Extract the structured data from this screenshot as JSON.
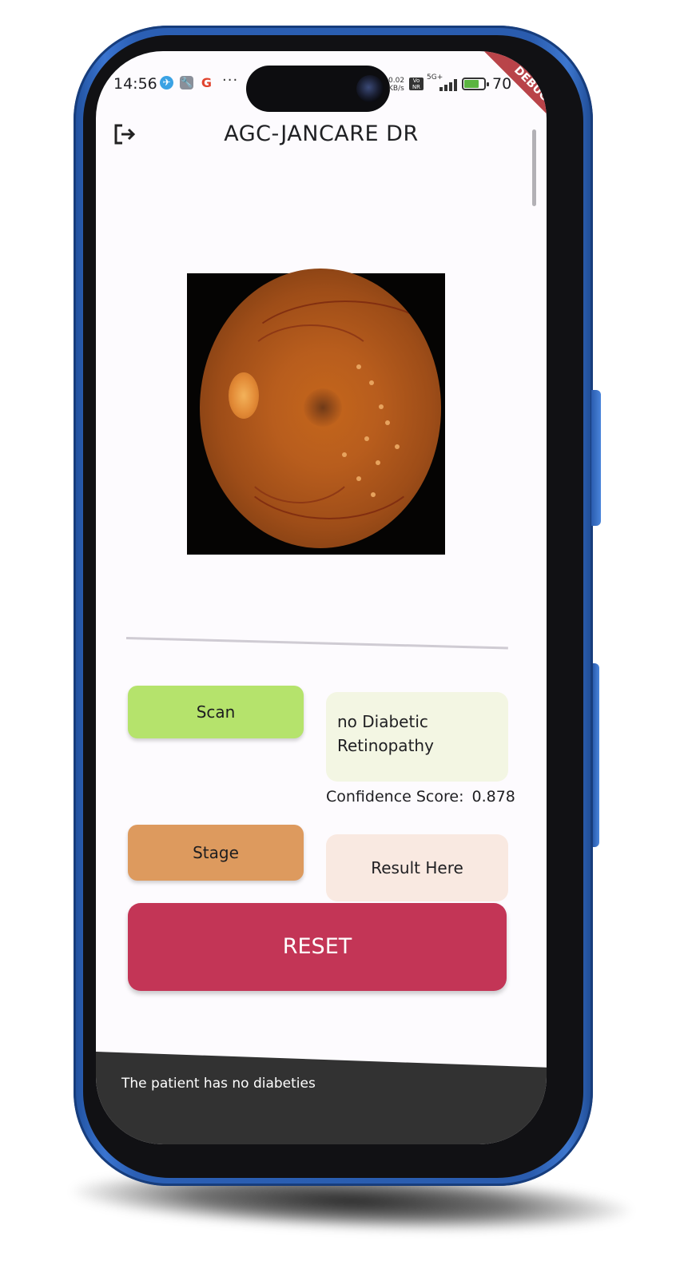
{
  "status_bar": {
    "time": "14:56",
    "more": "···",
    "net_speed": "0.02 KB/s",
    "network": "5G+",
    "battery": "70",
    "debug_banner": "DEBUG"
  },
  "app_bar": {
    "title": "AGC-JANCARE DR"
  },
  "actions": {
    "scan_label": "Scan",
    "scan_result": "no Diabetic Retinopathy",
    "confidence_label": "Confidence Score:",
    "confidence_value": "0.878",
    "stage_label": "Stage",
    "stage_result": "Result Here",
    "reset_label": "RESET"
  },
  "snackbar": {
    "message": "The patient has no diabeties"
  },
  "colors": {
    "scan": "#b5e36c",
    "stage": "#dd9a5e",
    "reset": "#c33556",
    "phone_frame": "#2a5cae"
  },
  "icons": [
    "logout-icon",
    "telegram-icon",
    "wrench-icon",
    "google-icon",
    "camera-icon",
    "signal-icon",
    "battery-icon"
  ]
}
